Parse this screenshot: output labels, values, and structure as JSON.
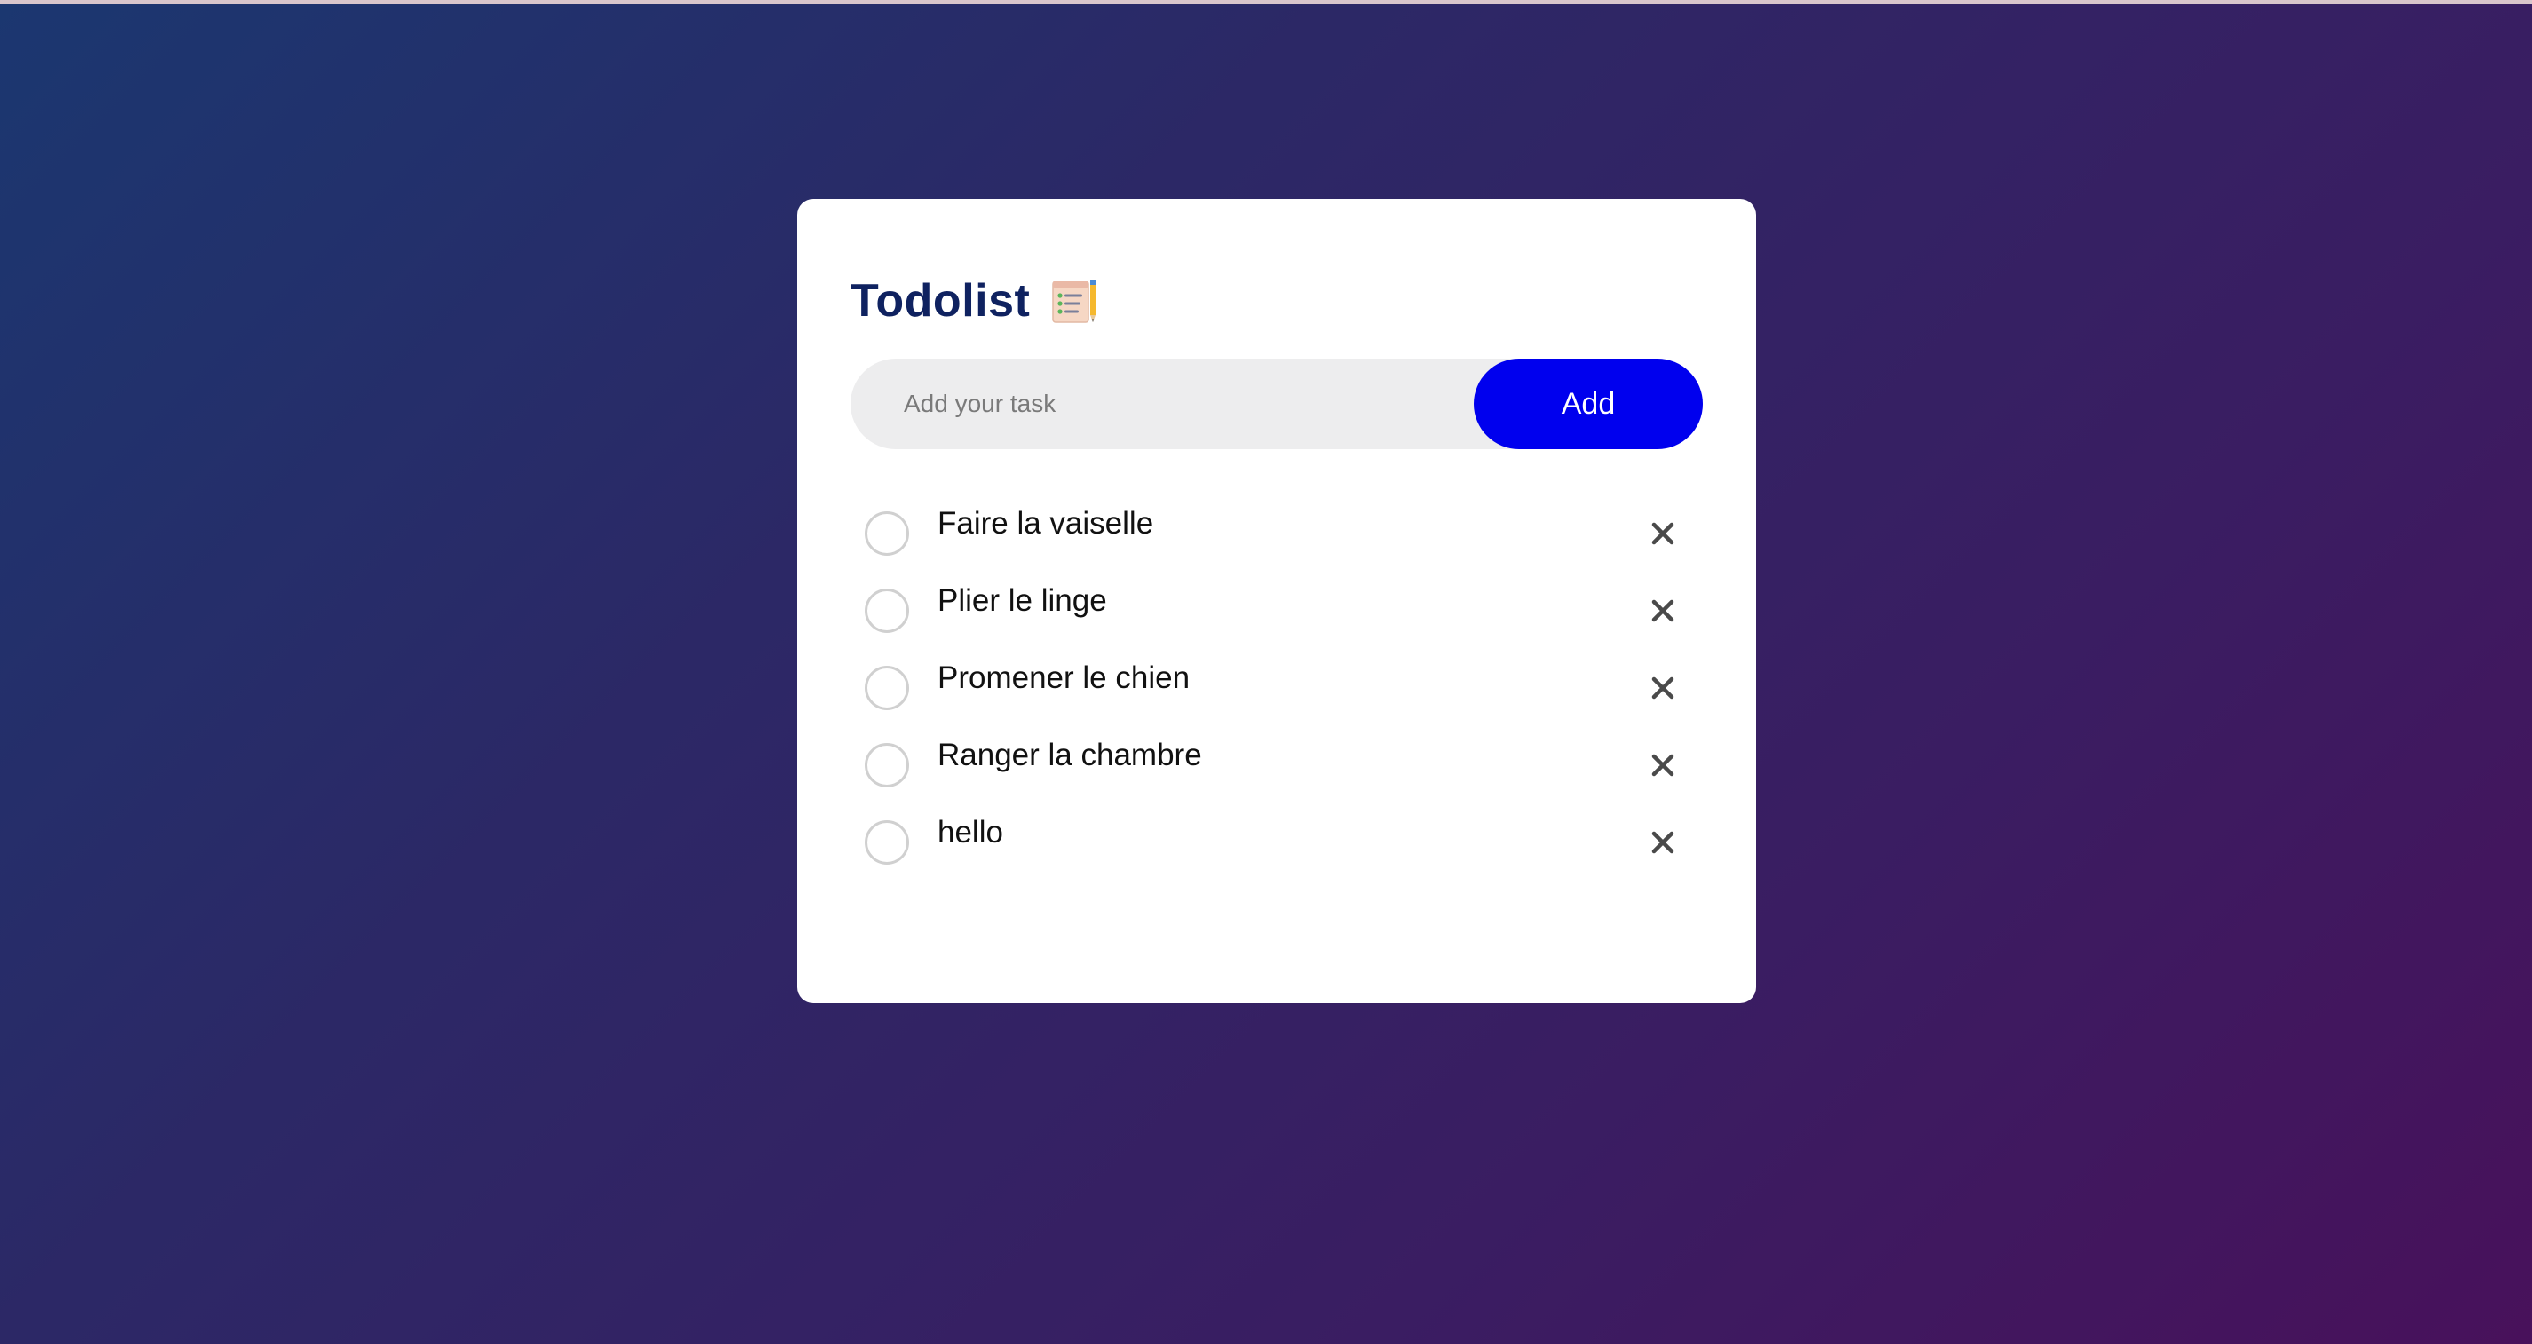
{
  "app": {
    "title": "Todolist",
    "title_icon": "notepad-checklist-icon"
  },
  "input": {
    "placeholder": "Add your task",
    "value": ""
  },
  "add_button": {
    "label": "Add",
    "color": "#0000ee"
  },
  "tasks": [
    {
      "label": "Faire la vaiselle",
      "checked": false
    },
    {
      "label": "Plier le linge",
      "checked": false
    },
    {
      "label": "Promener le chien",
      "checked": false
    },
    {
      "label": "Ranger la chambre",
      "checked": false
    },
    {
      "label": "hello",
      "checked": false
    }
  ],
  "icons": {
    "check": "empty-circle-icon",
    "delete": "close-icon"
  },
  "colors": {
    "title": "#0f2260",
    "background_start": "#1b3770",
    "background_end": "#48115b"
  }
}
